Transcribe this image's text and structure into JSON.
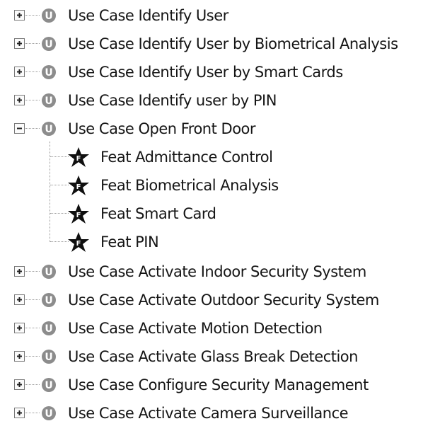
{
  "tree": {
    "top_nodes_before": [
      {
        "label": "Use Case Identify User",
        "state": "collapsed",
        "icon": "use-case-icon"
      },
      {
        "label": "Use Case Identify User by Biometrical Analysis",
        "state": "collapsed",
        "icon": "use-case-icon"
      },
      {
        "label": "Use Case Identify User by Smart Cards",
        "state": "collapsed",
        "icon": "use-case-icon"
      },
      {
        "label": "Use Case Identify user by PIN",
        "state": "collapsed",
        "icon": "use-case-icon"
      }
    ],
    "expanded_node": {
      "label": "Use Case Open Front Door",
      "state": "expanded",
      "icon": "use-case-icon",
      "children": [
        {
          "label": "Feat Admittance Control",
          "icon": "feature-star-icon"
        },
        {
          "label": "Feat Biometrical Analysis",
          "icon": "feature-star-icon"
        },
        {
          "label": "Feat Smart Card",
          "icon": "feature-star-icon"
        },
        {
          "label": "Feat PIN",
          "icon": "feature-star-icon"
        }
      ]
    },
    "top_nodes_after": [
      {
        "label": "Use Case Activate Indoor Security System",
        "state": "collapsed",
        "icon": "use-case-icon"
      },
      {
        "label": "Use Case Activate Outdoor Security System",
        "state": "collapsed",
        "icon": "use-case-icon"
      },
      {
        "label": "Use Case Activate Motion Detection",
        "state": "collapsed",
        "icon": "use-case-icon"
      },
      {
        "label": "Use Case Activate Glass Break Detection",
        "state": "collapsed",
        "icon": "use-case-icon"
      },
      {
        "label": "Use Case Configure Security Management",
        "state": "collapsed",
        "icon": "use-case-icon"
      },
      {
        "label": "Use Case Activate Camera Surveillance",
        "state": "collapsed",
        "icon": "use-case-icon"
      }
    ],
    "colors": {
      "use_case_circle": "#8c8c8c",
      "use_case_letter": "#ffffff",
      "star": "#101010",
      "star_letter": "#ffffff",
      "connector": "#9a9a9a"
    },
    "icon_letters": {
      "use_case": "U",
      "feature": "F"
    }
  }
}
